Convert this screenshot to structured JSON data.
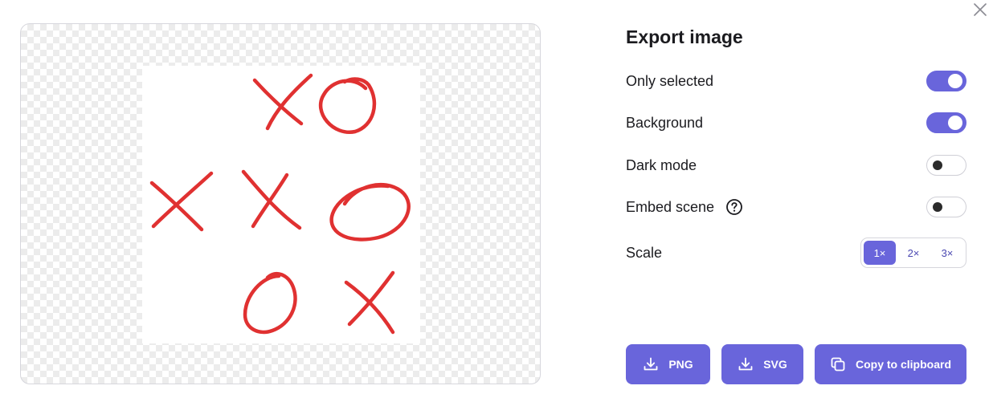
{
  "dialog": {
    "title": "Export image",
    "close_icon": "close-icon"
  },
  "options": [
    {
      "key": "only_selected",
      "label": "Only selected",
      "enabled": true
    },
    {
      "key": "background",
      "label": "Background",
      "enabled": true
    },
    {
      "key": "dark_mode",
      "label": "Dark mode",
      "enabled": false
    },
    {
      "key": "embed_scene",
      "label": "Embed scene",
      "enabled": false,
      "help_icon": "help-circle-icon"
    }
  ],
  "scale": {
    "label": "Scale",
    "options": [
      "1×",
      "2×",
      "3×"
    ],
    "selected": "1×"
  },
  "actions": {
    "png_label": "PNG",
    "svg_label": "SVG",
    "clipboard_label": "Copy to clipboard",
    "png_icon": "download-icon",
    "svg_icon": "download-icon",
    "clipboard_icon": "copy-icon"
  },
  "preview": {
    "grid": [
      [
        "",
        "X",
        "O"
      ],
      [
        "X",
        "X",
        "O"
      ],
      [
        "",
        "O",
        "X"
      ]
    ],
    "ink_color": "#e03131"
  },
  "colors": {
    "accent": "#6965db",
    "text": "#1b1b1f",
    "accent_text": "#4a47b1"
  }
}
